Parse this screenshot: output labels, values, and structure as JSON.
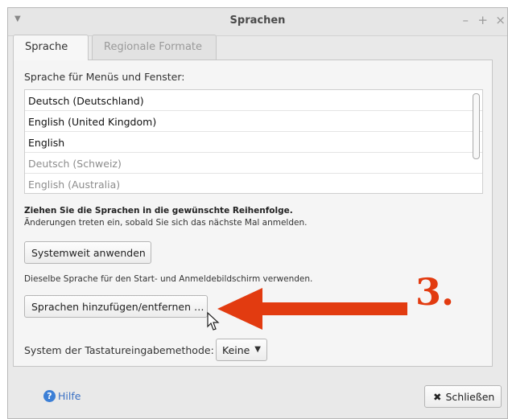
{
  "window": {
    "title": "Sprachen",
    "controls": {
      "minimize": "–",
      "maximize": "+",
      "close": "×"
    }
  },
  "tabs": [
    {
      "label": "Sprache",
      "active": true
    },
    {
      "label": "Regionale Formate",
      "active": false
    }
  ],
  "language_panel": {
    "menus_label": "Sprache für Menüs und Fenster:",
    "languages": [
      {
        "name": "Deutsch (Deutschland)",
        "enabled": true
      },
      {
        "name": "English (United Kingdom)",
        "enabled": true
      },
      {
        "name": "English",
        "enabled": true
      },
      {
        "name": "Deutsch (Schweiz)",
        "enabled": false
      },
      {
        "name": "English (Australia)",
        "enabled": false
      }
    ],
    "drag_hint": "Ziehen Sie die Sprachen in die gewünschte Reihenfolge.",
    "apply_note": "Änderungen treten ein, sobald Sie sich das nächste Mal anmelden.",
    "systemwide_button": "Systemweit anwenden",
    "login_note": "Dieselbe Sprache für den Start- und Anmeldebildschirm verwenden.",
    "add_remove_button": "Sprachen hinzufügen/entfernen …",
    "keyboard_label": "System der Tastatureingabemethode:",
    "keyboard_value": "Keine"
  },
  "footer": {
    "help_label": "Hilfe",
    "close_label": "Schließen"
  },
  "annotation": {
    "step_number": "3.",
    "color": "#e23b10"
  },
  "icons": {
    "help": "question-circle-icon",
    "close": "x-icon",
    "dropdown": "chevron-down-icon",
    "cursor": "mouse-pointer-icon"
  }
}
